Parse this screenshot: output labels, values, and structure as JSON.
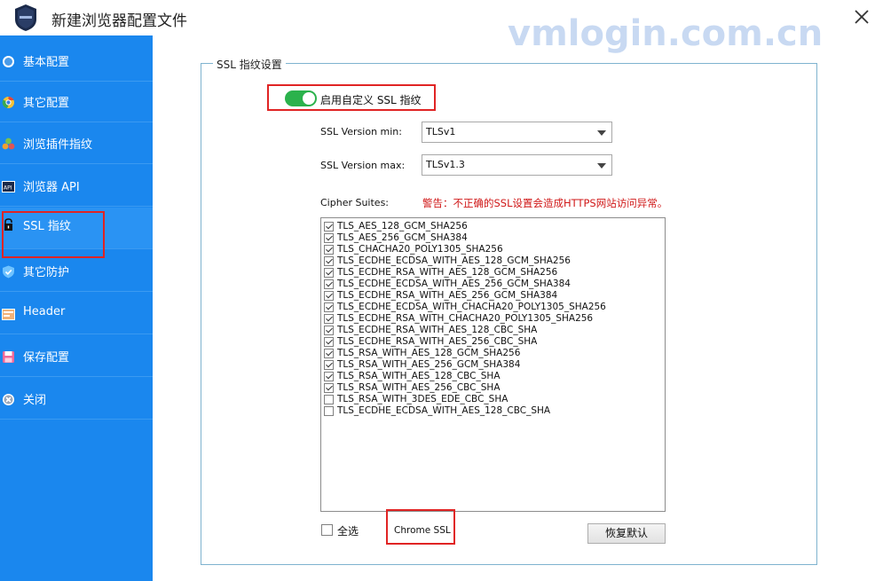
{
  "window": {
    "title": "新建浏览器配置文件",
    "watermark": "vmlogin.com.cn"
  },
  "sidebar": {
    "items": [
      {
        "label": "基本配置",
        "icon": "compass-icon"
      },
      {
        "label": "其它配置",
        "icon": "chrome-icon"
      },
      {
        "label": "浏览插件指纹",
        "icon": "plugin-icon"
      },
      {
        "label": "浏览器 API",
        "icon": "api-icon"
      },
      {
        "label": "SSL 指纹",
        "icon": "lock-icon"
      },
      {
        "label": "其它防护",
        "icon": "shield-icon"
      },
      {
        "label": "Header",
        "icon": "header-icon"
      },
      {
        "label": "保存配置",
        "icon": "save-icon"
      },
      {
        "label": "关闭",
        "icon": "close-circle-icon"
      }
    ],
    "selected": "SSL 指纹"
  },
  "ssl": {
    "group_title": "SSL 指纹设置",
    "toggle_label": "启用自定义 SSL 指纹",
    "toggle_on": true,
    "version_min_label": "SSL Version min:",
    "version_min_value": "TLSv1",
    "version_max_label": "SSL Version max:",
    "version_max_value": "TLSv1.3",
    "cipher_label": "Cipher Suites:",
    "warning": "警告：不正确的SSL设置会造成HTTPS网站访问异常。",
    "cipher_suites": [
      {
        "name": "TLS_AES_128_GCM_SHA256",
        "checked": true
      },
      {
        "name": "TLS_AES_256_GCM_SHA384",
        "checked": true
      },
      {
        "name": "TLS_CHACHA20_POLY1305_SHA256",
        "checked": true
      },
      {
        "name": "TLS_ECDHE_ECDSA_WITH_AES_128_GCM_SHA256",
        "checked": true
      },
      {
        "name": "TLS_ECDHE_RSA_WITH_AES_128_GCM_SHA256",
        "checked": true
      },
      {
        "name": "TLS_ECDHE_ECDSA_WITH_AES_256_GCM_SHA384",
        "checked": true
      },
      {
        "name": "TLS_ECDHE_RSA_WITH_AES_256_GCM_SHA384",
        "checked": true
      },
      {
        "name": "TLS_ECDHE_ECDSA_WITH_CHACHA20_POLY1305_SHA256",
        "checked": true
      },
      {
        "name": "TLS_ECDHE_RSA_WITH_CHACHA20_POLY1305_SHA256",
        "checked": true
      },
      {
        "name": "TLS_ECDHE_RSA_WITH_AES_128_CBC_SHA",
        "checked": true
      },
      {
        "name": "TLS_ECDHE_RSA_WITH_AES_256_CBC_SHA",
        "checked": true
      },
      {
        "name": "TLS_RSA_WITH_AES_128_GCM_SHA256",
        "checked": true
      },
      {
        "name": "TLS_RSA_WITH_AES_256_GCM_SHA384",
        "checked": true
      },
      {
        "name": "TLS_RSA_WITH_AES_128_CBC_SHA",
        "checked": true
      },
      {
        "name": "TLS_RSA_WITH_AES_256_CBC_SHA",
        "checked": true
      },
      {
        "name": "TLS_RSA_WITH_3DES_EDE_CBC_SHA",
        "checked": false
      },
      {
        "name": "TLS_ECDHE_ECDSA_WITH_AES_128_CBC_SHA",
        "checked": false
      }
    ],
    "select_all_label": "全选",
    "chrome_ssl_label": "Chrome SSL",
    "restore_default_label": "恢复默认"
  },
  "colors": {
    "sidebar_bg": "#1a87ee",
    "toggle_on": "#2bb24c",
    "warning_text": "#d01818",
    "highlight_box": "#e02424"
  }
}
